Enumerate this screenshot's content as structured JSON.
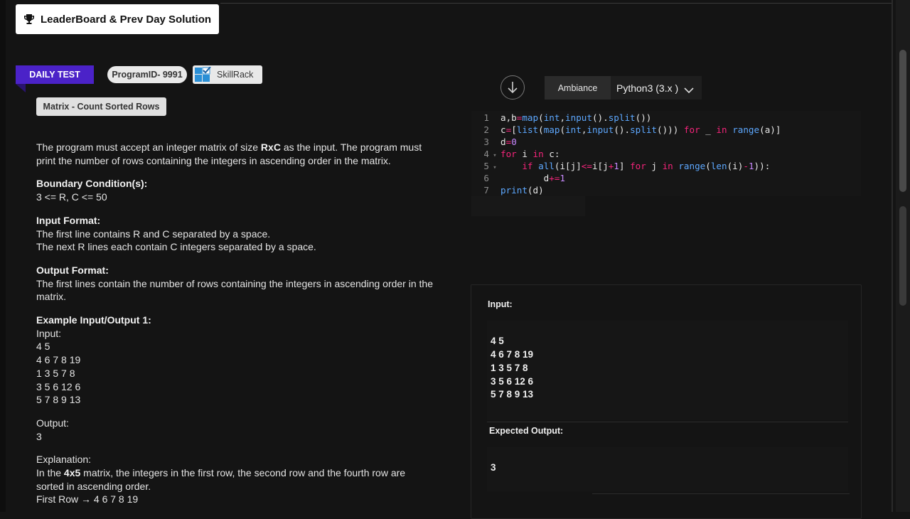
{
  "header": {
    "leaderboard_label": "LeaderBoard & Prev Day Solution"
  },
  "tags": {
    "daily_test": "DAILY TEST",
    "program_id": "ProgramID- 9991",
    "skillrack": "SkillRack",
    "problem_title": "Matrix - Count Sorted Rows"
  },
  "problem": {
    "intro_1": "The program must accept an integer matrix of size ",
    "intro_bold": "RxC",
    "intro_2": " as the input. The program must print the number of rows containing the integers in ascending order in the matrix.",
    "boundary_heading": "Boundary Condition(s):",
    "boundary_text": "3 <= R, C <= 50",
    "input_heading": "Input Format:",
    "input_line_1": "The first line contains R and C separated by a space.",
    "input_line_2": "The next R lines each contain C integers separated by a space.",
    "output_heading": "Output Format:",
    "output_text": "The first lines contain the number of rows containing the integers in ascending order in the matrix.",
    "example_heading": "Example Input/Output 1:",
    "example_input_label": "Input:",
    "example_input_lines": [
      "4 5",
      "4 6 7 8 19",
      "1 3 5 7 8",
      "3 5 6 12 6",
      "5 7 8 9 13"
    ],
    "example_output_label": "Output:",
    "example_output_value": "3",
    "explanation_label": "Explanation:",
    "explanation_1": "In the ",
    "explanation_bold": "4x5",
    "explanation_2": " matrix, the integers in the first row, the second row and the fourth row are sorted in ascending order.",
    "explanation_cut": "First Row → 4 6 7 8 19"
  },
  "editor": {
    "theme": "Ambiance",
    "language": "Python3 (3.x )",
    "line_numbers": [
      "1",
      "2",
      "3",
      "4",
      "5",
      "6",
      "7"
    ]
  },
  "io": {
    "input_label": "Input:",
    "input_lines": [
      "4 5",
      "4 6 7 8 19",
      "1 3 5 7 8",
      "3 5 6 12 6",
      "5 7 8 9 13"
    ],
    "expected_label": "Expected Output:",
    "expected_value": "3"
  },
  "colors": {
    "daily_tag": "#4b22c8",
    "keyword": "#f4247a",
    "function": "#5da8ff",
    "number": "#c98aff"
  }
}
